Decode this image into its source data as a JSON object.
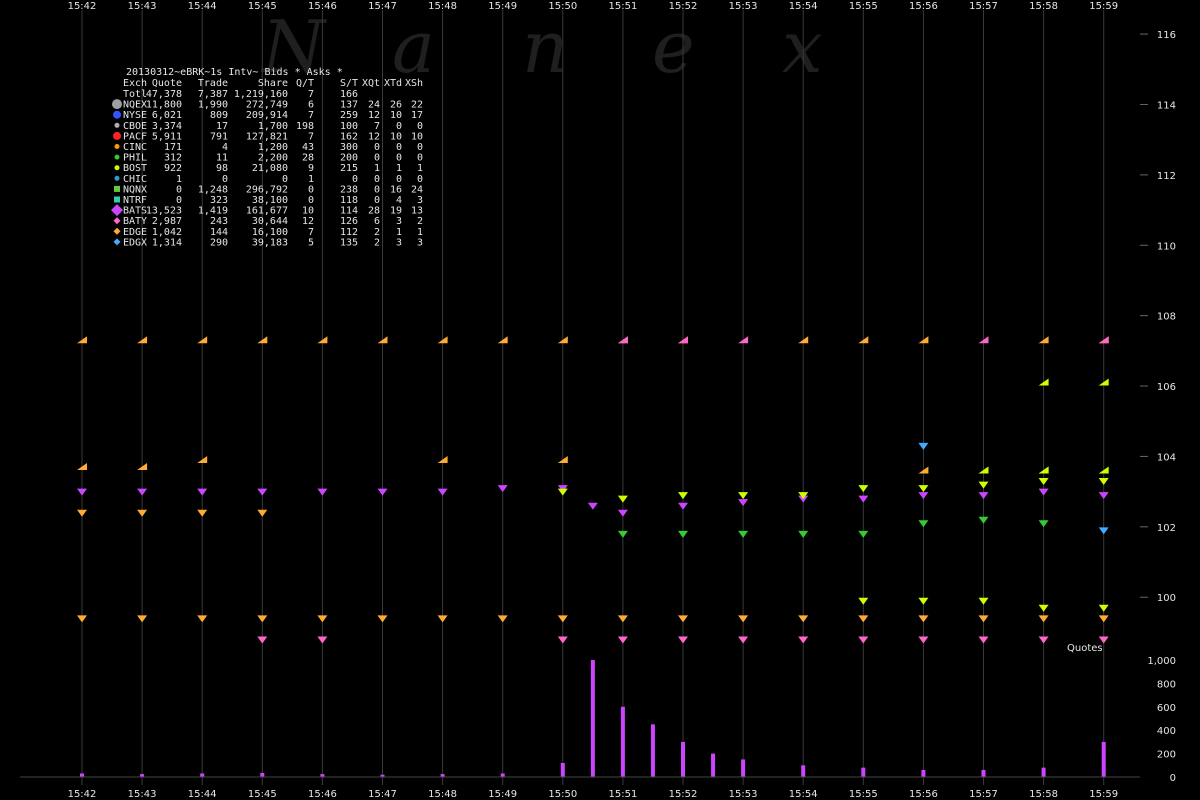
{
  "chart_data": {
    "type": "scatter",
    "title": "20130312~eBRK~1s Intv~ Bids * Asks *",
    "watermark": [
      "N",
      "a",
      "n",
      "e",
      "x"
    ],
    "x_ticks": [
      "15:42",
      "15:43",
      "15:44",
      "15:45",
      "15:46",
      "15:47",
      "15:48",
      "15:49",
      "15:50",
      "15:51",
      "15:52",
      "15:53",
      "15:54",
      "15:55",
      "15:56",
      "15:57",
      "15:58",
      "15:59"
    ],
    "price_axis": {
      "ylim": [
        98.5,
        116.4
      ],
      "ticks": [
        "116",
        "114",
        "112",
        "110",
        "108",
        "106",
        "104",
        "102",
        "100"
      ],
      "tick_values": [
        116,
        114,
        112,
        110,
        108,
        106,
        104,
        102,
        100
      ]
    },
    "quotes_axis": {
      "label": "Quotes",
      "ylim": [
        0,
        1000
      ],
      "ticks": [
        "1,000",
        "800",
        "600",
        "400",
        "200",
        "0"
      ],
      "tick_values": [
        1000,
        800,
        600,
        400,
        200,
        0
      ]
    },
    "stats_header": [
      "Exch",
      "Quote",
      "Trade",
      "Share",
      "Q/T",
      "S/T",
      "XQt",
      "XTd",
      "XSh"
    ],
    "stats_rows": [
      {
        "exch": "Totl",
        "quote": "47,378",
        "trade": "7,387",
        "share": "1,219,160",
        "qt": "7",
        "st": "166",
        "xqt": "",
        "xtd": "",
        "xsh": "",
        "color": "",
        "marker": "none"
      },
      {
        "exch": "NQEX",
        "quote": "11,800",
        "trade": "1,990",
        "share": "272,749",
        "qt": "6",
        "st": "137",
        "xqt": "24",
        "xtd": "26",
        "xsh": "22",
        "color": "#a0a0a0",
        "marker": "circle-big"
      },
      {
        "exch": "NYSE",
        "quote": "6,021",
        "trade": "809",
        "share": "209,914",
        "qt": "7",
        "st": "259",
        "xqt": "12",
        "xtd": "10",
        "xsh": "17",
        "color": "#3355ff",
        "marker": "circle"
      },
      {
        "exch": "CBOE",
        "quote": "3,374",
        "trade": "17",
        "share": "1,700",
        "qt": "198",
        "st": "100",
        "xqt": "7",
        "xtd": "0",
        "xsh": "0",
        "color": "#b0b0b0",
        "marker": "circle-small"
      },
      {
        "exch": "PACF",
        "quote": "5,911",
        "trade": "791",
        "share": "127,821",
        "qt": "7",
        "st": "162",
        "xqt": "12",
        "xtd": "10",
        "xsh": "10",
        "color": "#ff2222",
        "marker": "circle"
      },
      {
        "exch": "CINC",
        "quote": "171",
        "trade": "4",
        "share": "1,200",
        "qt": "43",
        "st": "300",
        "xqt": "0",
        "xtd": "0",
        "xsh": "0",
        "color": "#ff9900",
        "marker": "circle-small"
      },
      {
        "exch": "PHIL",
        "quote": "312",
        "trade": "11",
        "share": "2,200",
        "qt": "28",
        "st": "200",
        "xqt": "0",
        "xtd": "0",
        "xsh": "0",
        "color": "#33cc33",
        "marker": "circle-small"
      },
      {
        "exch": "BOST",
        "quote": "922",
        "trade": "98",
        "share": "21,080",
        "qt": "9",
        "st": "215",
        "xqt": "1",
        "xtd": "1",
        "xsh": "1",
        "color": "#ccff00",
        "marker": "circle-small"
      },
      {
        "exch": "CHIC",
        "quote": "1",
        "trade": "0",
        "share": "0",
        "qt": "1",
        "st": "0",
        "xqt": "0",
        "xtd": "0",
        "xsh": "0",
        "color": "#3399cc",
        "marker": "circle-small"
      },
      {
        "exch": "NQNX",
        "quote": "0",
        "trade": "1,248",
        "share": "296,792",
        "qt": "0",
        "st": "238",
        "xqt": "0",
        "xtd": "16",
        "xsh": "24",
        "color": "#66cc33",
        "marker": "square"
      },
      {
        "exch": "NTRF",
        "quote": "0",
        "trade": "323",
        "share": "38,100",
        "qt": "0",
        "st": "118",
        "xqt": "0",
        "xtd": "4",
        "xsh": "3",
        "color": "#33ccaa",
        "marker": "square"
      },
      {
        "exch": "BATS",
        "quote": "13,523",
        "trade": "1,419",
        "share": "161,677",
        "qt": "10",
        "st": "114",
        "xqt": "28",
        "xtd": "19",
        "xsh": "13",
        "color": "#cc44ff",
        "marker": "diamond-big"
      },
      {
        "exch": "BATY",
        "quote": "2,987",
        "trade": "243",
        "share": "30,644",
        "qt": "12",
        "st": "126",
        "xqt": "6",
        "xtd": "3",
        "xsh": "2",
        "color": "#ff66cc",
        "marker": "diamond"
      },
      {
        "exch": "EDGE",
        "quote": "1,042",
        "trade": "144",
        "share": "16,100",
        "qt": "7",
        "st": "112",
        "xqt": "2",
        "xtd": "1",
        "xsh": "1",
        "color": "#ffaa33",
        "marker": "diamond"
      },
      {
        "exch": "EDGX",
        "quote": "1,314",
        "trade": "290",
        "share": "39,183",
        "qt": "5",
        "st": "135",
        "xqt": "2",
        "xtd": "3",
        "xsh": "3",
        "color": "#44aaff",
        "marker": "diamond"
      }
    ],
    "series": [
      {
        "exch": "EDGE",
        "kind": "ask",
        "color": "#ffaa33",
        "points": [
          [
            15.42,
            107.3
          ],
          [
            15.43,
            107.3
          ],
          [
            15.44,
            107.3
          ],
          [
            15.45,
            107.3
          ],
          [
            15.46,
            107.3
          ],
          [
            15.47,
            107.3
          ],
          [
            15.48,
            107.3
          ],
          [
            15.49,
            107.3
          ],
          [
            15.5,
            107.3
          ],
          [
            15.51,
            107.3
          ],
          [
            15.52,
            107.3
          ],
          [
            15.54,
            107.3
          ],
          [
            15.55,
            107.3
          ],
          [
            15.56,
            107.3
          ],
          [
            15.58,
            107.3
          ],
          [
            15.59,
            107.3
          ]
        ]
      },
      {
        "exch": "BATY",
        "kind": "ask",
        "color": "#ff66cc",
        "points": [
          [
            15.51,
            107.3
          ],
          [
            15.52,
            107.3
          ],
          [
            15.53,
            107.3
          ],
          [
            15.57,
            107.3
          ],
          [
            15.59,
            107.3
          ]
        ]
      },
      {
        "exch": "EDGE",
        "kind": "ask",
        "color": "#ffaa33",
        "points": [
          [
            15.42,
            103.7
          ],
          [
            15.43,
            103.7
          ],
          [
            15.44,
            103.9
          ],
          [
            15.48,
            103.9
          ],
          [
            15.5,
            103.9
          ],
          [
            15.56,
            103.6
          ],
          [
            15.57,
            103.6
          ],
          [
            15.58,
            103.6
          ]
        ]
      },
      {
        "exch": "BOST",
        "kind": "ask",
        "color": "#ccff00",
        "points": [
          [
            15.57,
            103.6
          ],
          [
            15.58,
            103.6
          ],
          [
            15.59,
            103.6
          ],
          [
            15.58,
            106.1
          ],
          [
            15.59,
            106.1
          ]
        ]
      },
      {
        "exch": "EDGX",
        "kind": "bid",
        "color": "#44aaff",
        "points": [
          [
            15.56,
            104.3
          ]
        ]
      },
      {
        "exch": "BATS",
        "kind": "bid",
        "color": "#cc44ff",
        "points": [
          [
            15.42,
            103.0
          ],
          [
            15.43,
            103.0
          ],
          [
            15.44,
            103.0
          ],
          [
            15.45,
            103.0
          ],
          [
            15.46,
            103.0
          ],
          [
            15.47,
            103.0
          ],
          [
            15.48,
            103.0
          ],
          [
            15.49,
            103.1
          ],
          [
            15.5,
            103.1
          ],
          [
            15.505,
            102.6
          ],
          [
            15.51,
            102.4
          ],
          [
            15.52,
            102.6
          ],
          [
            15.53,
            102.7
          ],
          [
            15.54,
            102.8
          ],
          [
            15.55,
            102.8
          ],
          [
            15.56,
            102.9
          ],
          [
            15.57,
            102.9
          ],
          [
            15.58,
            103.0
          ],
          [
            15.59,
            102.9
          ]
        ]
      },
      {
        "exch": "BOST",
        "kind": "bid",
        "color": "#ccff00",
        "points": [
          [
            15.5,
            103.0
          ],
          [
            15.51,
            102.8
          ],
          [
            15.52,
            102.9
          ],
          [
            15.53,
            102.9
          ],
          [
            15.54,
            102.9
          ],
          [
            15.55,
            103.1
          ],
          [
            15.56,
            103.1
          ],
          [
            15.57,
            103.2
          ],
          [
            15.58,
            103.3
          ],
          [
            15.59,
            103.3
          ]
        ]
      },
      {
        "exch": "PHIL",
        "kind": "bid",
        "color": "#33cc33",
        "points": [
          [
            15.51,
            101.8
          ],
          [
            15.52,
            101.8
          ],
          [
            15.53,
            101.8
          ],
          [
            15.54,
            101.8
          ],
          [
            15.55,
            101.8
          ],
          [
            15.56,
            102.1
          ],
          [
            15.57,
            102.2
          ],
          [
            15.58,
            102.1
          ]
        ]
      },
      {
        "exch": "EDGE",
        "kind": "bid",
        "color": "#ffaa33",
        "points": [
          [
            15.42,
            102.4
          ],
          [
            15.43,
            102.4
          ],
          [
            15.44,
            102.4
          ],
          [
            15.45,
            102.4
          ],
          [
            15.42,
            99.4
          ],
          [
            15.43,
            99.4
          ],
          [
            15.44,
            99.4
          ],
          [
            15.45,
            99.4
          ],
          [
            15.46,
            99.4
          ],
          [
            15.47,
            99.4
          ],
          [
            15.48,
            99.4
          ],
          [
            15.49,
            99.4
          ],
          [
            15.5,
            99.4
          ],
          [
            15.51,
            99.4
          ],
          [
            15.52,
            99.4
          ],
          [
            15.53,
            99.4
          ],
          [
            15.54,
            99.4
          ],
          [
            15.55,
            99.4
          ],
          [
            15.56,
            99.4
          ],
          [
            15.57,
            99.4
          ],
          [
            15.58,
            99.4
          ],
          [
            15.59,
            99.4
          ]
        ]
      },
      {
        "exch": "BOST",
        "kind": "bid",
        "color": "#ccff00",
        "points": [
          [
            15.55,
            99.9
          ],
          [
            15.56,
            99.9
          ],
          [
            15.57,
            99.9
          ],
          [
            15.58,
            99.7
          ],
          [
            15.59,
            99.7
          ]
        ]
      },
      {
        "exch": "BATY",
        "kind": "bid",
        "color": "#ff66cc",
        "points": [
          [
            15.45,
            98.8
          ],
          [
            15.46,
            98.8
          ],
          [
            15.5,
            98.8
          ],
          [
            15.51,
            98.8
          ],
          [
            15.52,
            98.8
          ],
          [
            15.53,
            98.8
          ],
          [
            15.54,
            98.8
          ],
          [
            15.55,
            98.8
          ],
          [
            15.56,
            98.8
          ],
          [
            15.57,
            98.8
          ],
          [
            15.58,
            98.8
          ],
          [
            15.59,
            98.8
          ]
        ]
      },
      {
        "exch": "EDGX",
        "kind": "bid",
        "color": "#44aaff",
        "points": [
          [
            15.59,
            101.9
          ]
        ]
      }
    ],
    "quotes_bars": [
      [
        15.42,
        30
      ],
      [
        15.43,
        25
      ],
      [
        15.44,
        30
      ],
      [
        15.45,
        35
      ],
      [
        15.46,
        25
      ],
      [
        15.47,
        20
      ],
      [
        15.48,
        25
      ],
      [
        15.49,
        30
      ],
      [
        15.5,
        120
      ],
      [
        15.505,
        1000
      ],
      [
        15.51,
        600
      ],
      [
        15.515,
        450
      ],
      [
        15.52,
        300
      ],
      [
        15.525,
        200
      ],
      [
        15.53,
        150
      ],
      [
        15.54,
        100
      ],
      [
        15.55,
        80
      ],
      [
        15.56,
        60
      ],
      [
        15.57,
        60
      ],
      [
        15.58,
        80
      ],
      [
        15.59,
        300
      ]
    ]
  }
}
